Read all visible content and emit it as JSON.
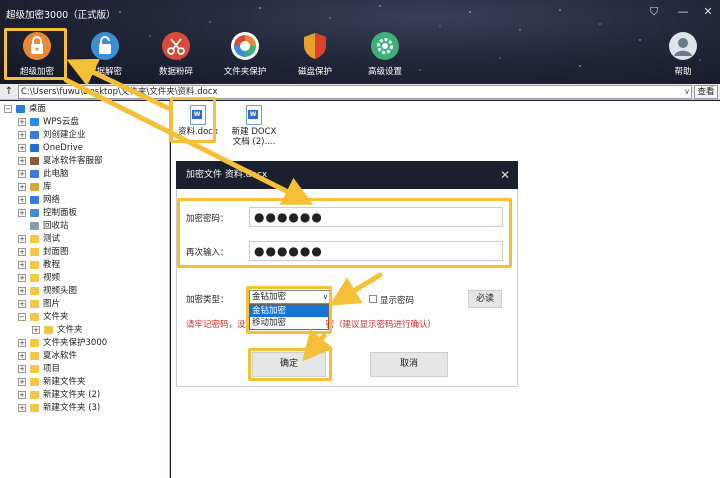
{
  "window": {
    "title": "超级加密3000（正式版）",
    "controls": {
      "skin": "⛉",
      "minimize": "—",
      "close": "✕"
    }
  },
  "toolbar": {
    "items": [
      {
        "label": "超级加密",
        "icon": "lock-icon",
        "color": "#e8893a"
      },
      {
        "label": "数据解密",
        "icon": "unlock-icon",
        "color": "#3a8fd8"
      },
      {
        "label": "数据粉碎",
        "icon": "scissors-icon",
        "color": "#d94a3a"
      },
      {
        "label": "文件夹保护",
        "icon": "shield-folder-icon",
        "color": "#e65c3a"
      },
      {
        "label": "磁盘保护",
        "icon": "disk-shield-icon",
        "color": "#e8a02a"
      },
      {
        "label": "高级设置",
        "icon": "gear-icon",
        "color": "#3ab07a"
      },
      {
        "label": "帮助",
        "icon": "user-help-icon",
        "color": "#6a7a8a"
      }
    ]
  },
  "pathbar": {
    "up": "↑",
    "path": "C:\\Users\\fuwu\\Desktop\\文件夹\\文件夹\\资料.docx",
    "dropdown": "∨",
    "view_button": "查看"
  },
  "tree": {
    "root": "桌面",
    "items": [
      {
        "label": "WPS云盘",
        "icon": "cloud-icon",
        "color": "#2b8be0"
      },
      {
        "label": "刘创建企业",
        "icon": "user-icon",
        "color": "#3a7ad8"
      },
      {
        "label": "OneDrive",
        "icon": "cloud-icon",
        "color": "#1f6fd0"
      },
      {
        "label": "夏冰软件客服部",
        "icon": "user-icon",
        "color": "#8a5a3a"
      },
      {
        "label": "此电脑",
        "icon": "computer-icon",
        "color": "#3a7ad8"
      },
      {
        "label": "库",
        "icon": "library-icon",
        "color": "#e0a53a"
      },
      {
        "label": "网络",
        "icon": "network-icon",
        "color": "#3a7ad8"
      },
      {
        "label": "控制面板",
        "icon": "control-panel-icon",
        "color": "#4a8ad0"
      },
      {
        "label": "回收站",
        "icon": "recycle-bin-icon",
        "color": "#8a9aaa"
      },
      {
        "label": "测试",
        "icon": "folder-icon",
        "color": "#f2c74a"
      },
      {
        "label": "封面图",
        "icon": "folder-icon",
        "color": "#f2c74a"
      },
      {
        "label": "教程",
        "icon": "folder-icon",
        "color": "#f2c74a"
      },
      {
        "label": "视频",
        "icon": "folder-icon",
        "color": "#f2c74a"
      },
      {
        "label": "视频头图",
        "icon": "folder-icon",
        "color": "#f2c74a"
      },
      {
        "label": "图片",
        "icon": "folder-icon",
        "color": "#f2c74a"
      },
      {
        "label": "文件夹",
        "icon": "folder-icon",
        "color": "#f2c74a"
      },
      {
        "label": "文件夹",
        "icon": "folder-icon",
        "color": "#f2c74a"
      },
      {
        "label": "文件夹保护3000",
        "icon": "folder-icon",
        "color": "#f2c74a"
      },
      {
        "label": "夏冰软件",
        "icon": "folder-icon",
        "color": "#f2c74a"
      },
      {
        "label": "项目",
        "icon": "folder-icon",
        "color": "#f2c74a"
      },
      {
        "label": "新建文件夹",
        "icon": "folder-icon",
        "color": "#f2c74a"
      },
      {
        "label": "新建文件夹 (2)",
        "icon": "folder-icon",
        "color": "#f2c74a"
      },
      {
        "label": "新建文件夹 (3)",
        "icon": "folder-icon",
        "color": "#f2c74a"
      }
    ]
  },
  "files": [
    {
      "name_line1": "资料.docx",
      "name_line2": ""
    },
    {
      "name_line1": "新建 DOCX",
      "name_line2": "文档 (2)...."
    }
  ],
  "dialog": {
    "title": "加密文件  资料.docx",
    "close": "✕",
    "password_label": "加密密码：",
    "password_value": "●●●●●●",
    "confirm_label": "再次输入：",
    "confirm_value": "●●●●●●",
    "type_label": "加密类型：",
    "type_selected": "金钻加密",
    "type_options": [
      "金钻加密",
      "移动加密"
    ],
    "show_password": "显示密码",
    "required_button": "必读",
    "warning_left": "请牢记密码，没",
    "warning_right": "密（建议显示密码进行确认）",
    "ok_button": "确定",
    "cancel_button": "取消"
  },
  "accent_color": "#f5c037"
}
